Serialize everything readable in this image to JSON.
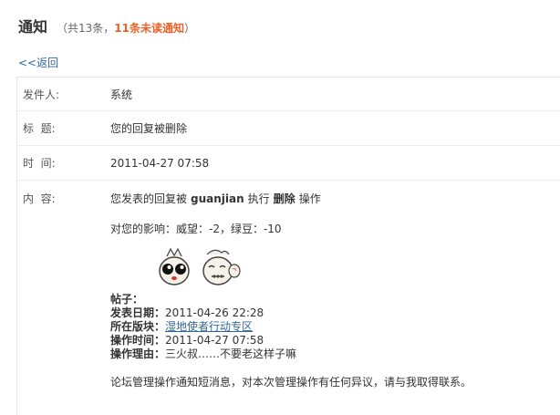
{
  "header": {
    "title": "通知",
    "count_prefix": "（共13条，",
    "unread": "11条未读通知",
    "count_suffix": "）"
  },
  "back_link": "<<返回",
  "rows": {
    "sender": {
      "label": "发件人:",
      "value": "系统"
    },
    "subject": {
      "label": "标  题:",
      "value": "您的回复被删除"
    },
    "time": {
      "label": "时  间:",
      "value": "2011-04-27 07:58"
    },
    "content": {
      "label": "内  容:",
      "line1_pre": "您发表的回复被",
      "user": "guanjian",
      "line1_mid": "执行",
      "action": "删除",
      "line1_post": "操作",
      "impact": "对您的影响：威望：-2，绿豆：-10",
      "post_label": "帖子：",
      "publish_date_label": "发表日期：",
      "publish_date": "2011-04-26 22:28",
      "board_label": "所在版块：",
      "board": "湿地使者行动专区",
      "op_time_label": "操作时间：",
      "op_time": "2011-04-27 07:58",
      "reason_label": "操作理由：",
      "reason": "三火叔……不要老这样子嘛",
      "footer": "论坛管理操作通知短消息，对本次管理操作有任何异议，请与我取得联系。"
    }
  },
  "colors": {
    "accent": "#e8622a",
    "link": "#336699"
  }
}
